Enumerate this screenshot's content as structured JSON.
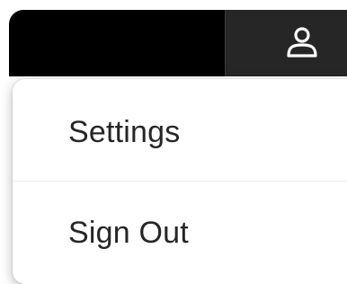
{
  "header": {
    "user_button_icon": "user-icon",
    "colors": {
      "bar": "#000000",
      "button": "#262626",
      "icon": "#ffffff"
    }
  },
  "menu": {
    "items": [
      {
        "label": "Settings"
      },
      {
        "label": "Sign Out"
      }
    ],
    "colors": {
      "background": "#ffffff",
      "text": "#262626"
    }
  }
}
